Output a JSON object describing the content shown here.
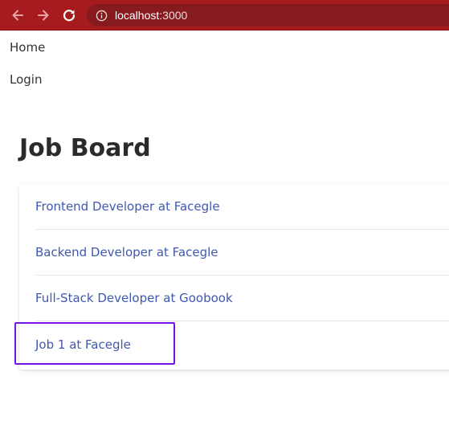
{
  "browser": {
    "url_host": "localhost",
    "url_port": ":3000"
  },
  "nav": {
    "home": "Home",
    "login": "Login"
  },
  "page": {
    "title": "Job Board"
  },
  "jobs": [
    {
      "label": "Frontend Developer at Facegle"
    },
    {
      "label": "Backend Developer at Facegle"
    },
    {
      "label": "Full-Stack Developer at Goobook"
    },
    {
      "label": "Job 1 at Facegle"
    }
  ],
  "colors": {
    "toolbar": "#a51b1e",
    "omnibox": "#861a1e",
    "link": "#3f58b0",
    "highlight": "#7a14e6"
  },
  "icons": {
    "back": "back-arrow-icon",
    "forward": "forward-arrow-icon",
    "reload": "reload-icon",
    "info": "info-icon"
  }
}
